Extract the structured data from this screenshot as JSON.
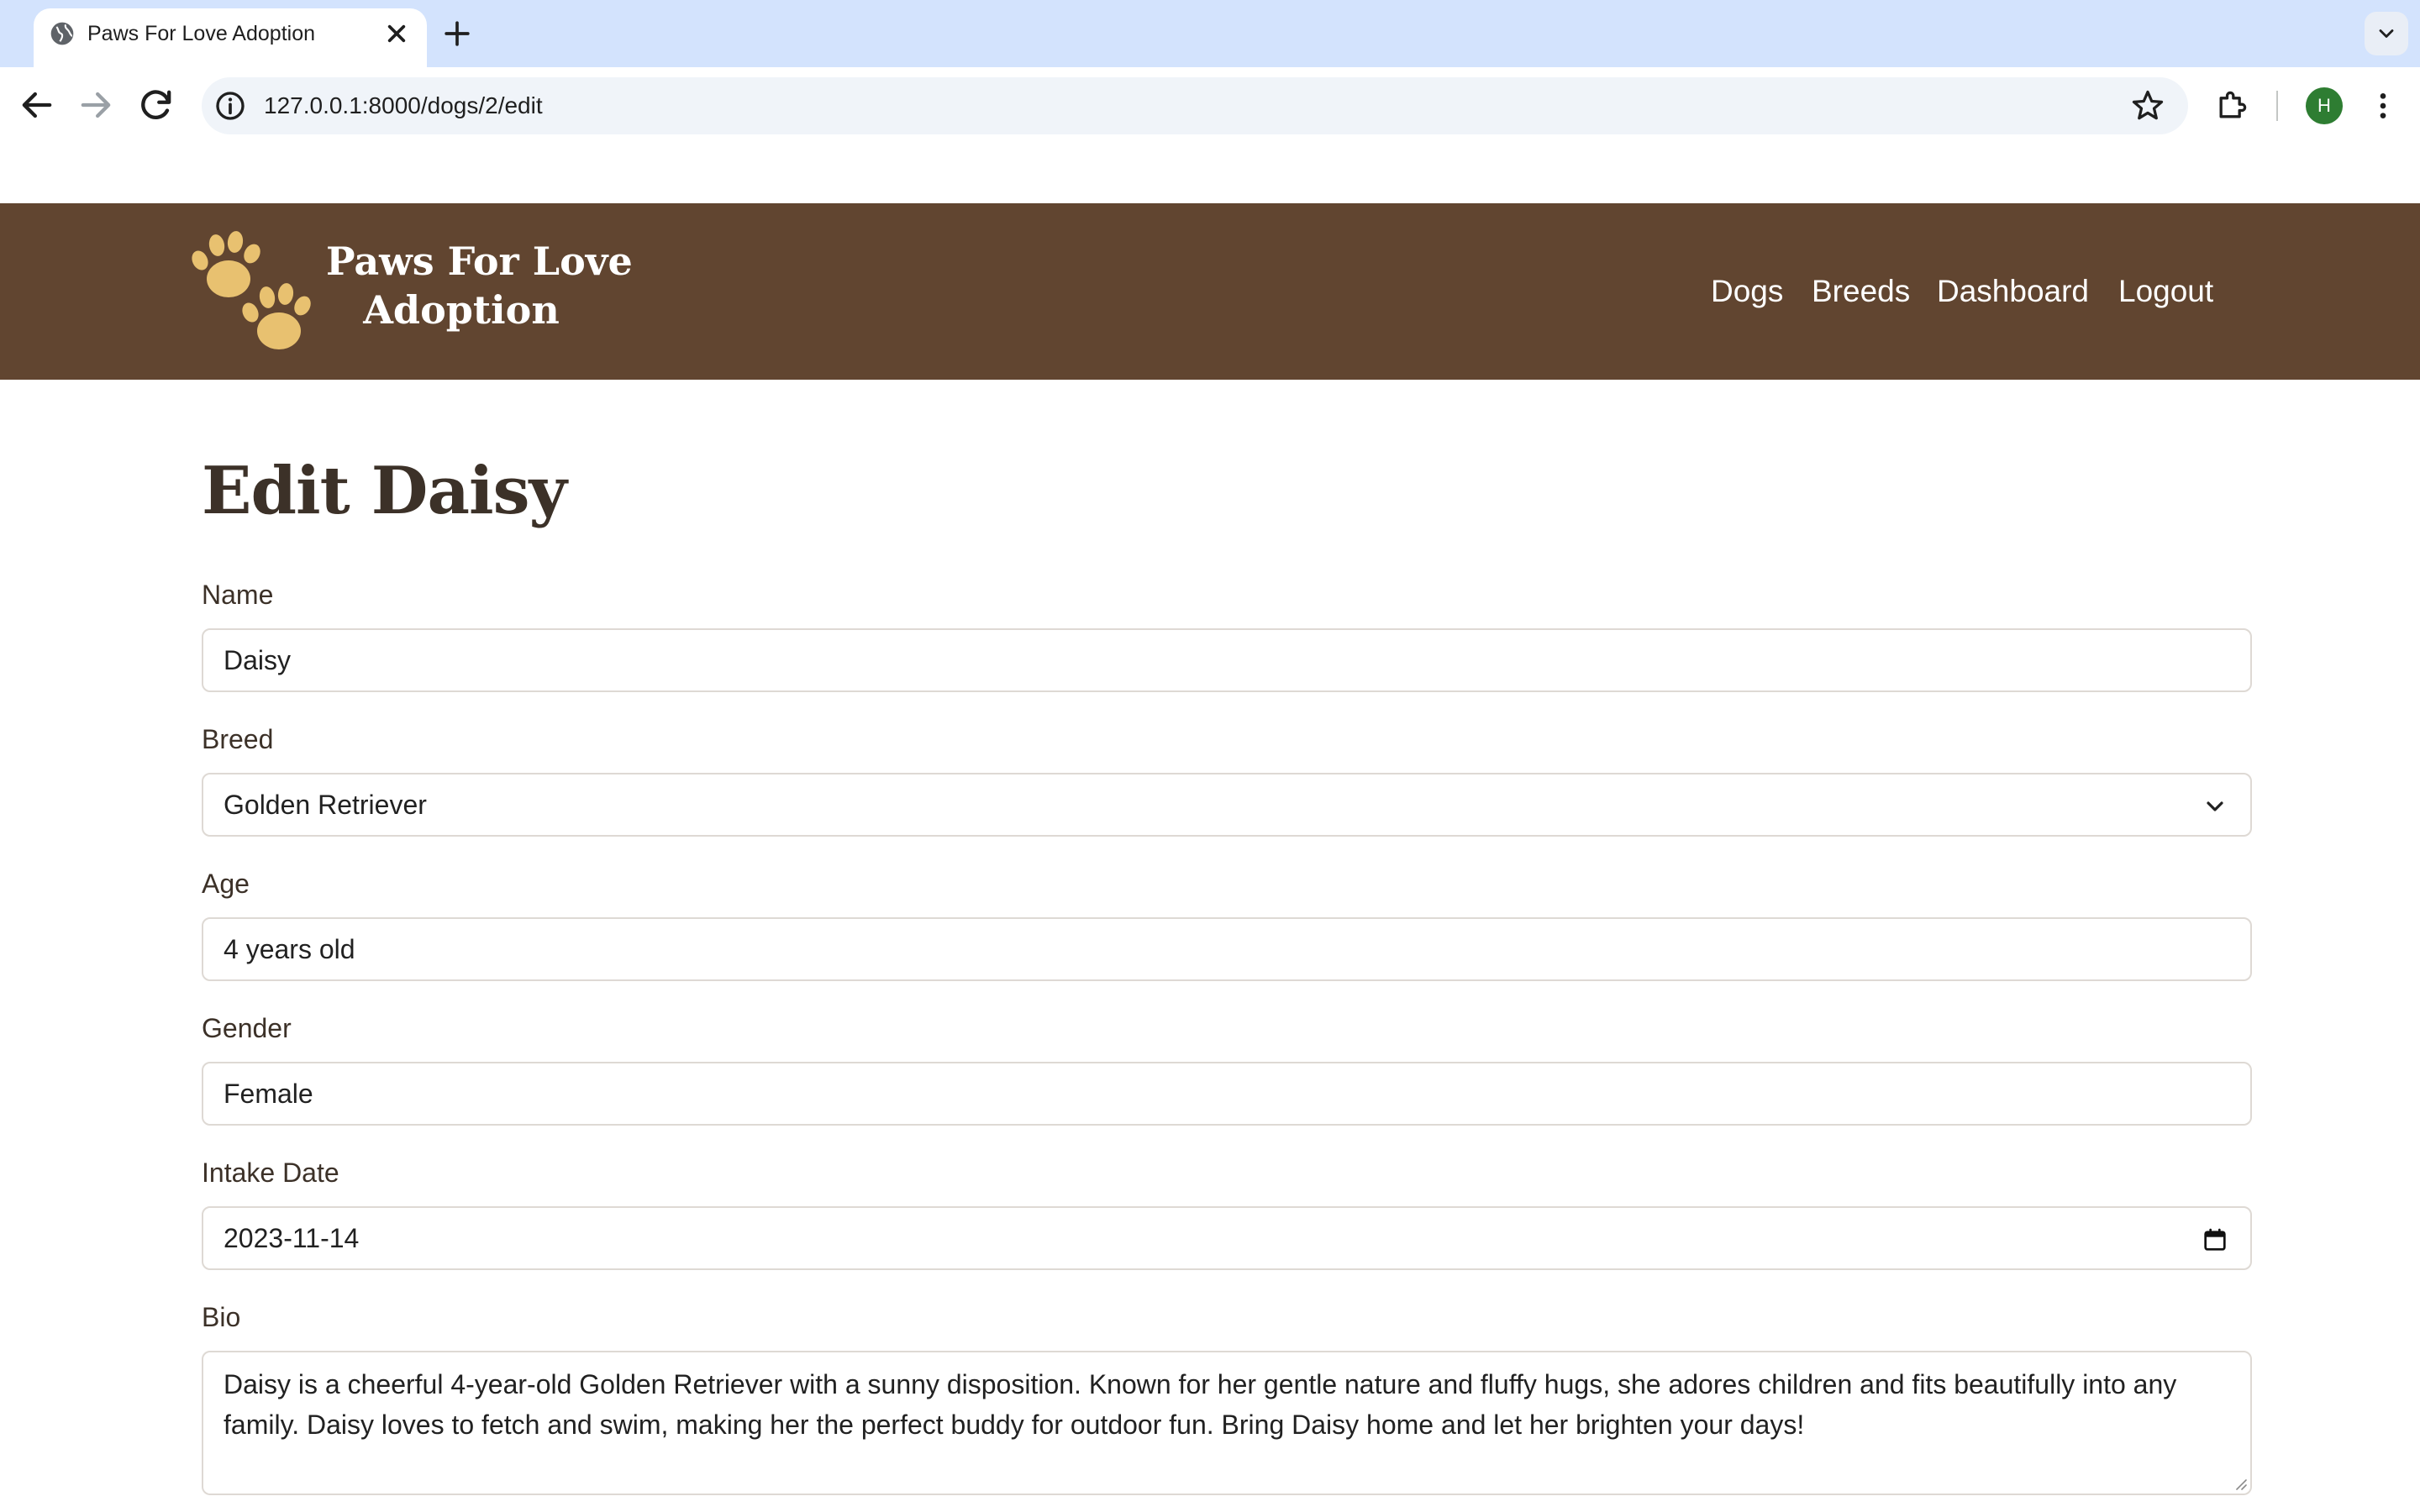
{
  "browser": {
    "tab_title": "Paws For Love Adoption",
    "url": "127.0.0.1:8000/dogs/2/edit",
    "profile_initial": "H"
  },
  "site": {
    "brand_line1": "Paws For Love",
    "brand_line2": "Adoption",
    "header_color": "#614530",
    "logo_color": "#e8c170",
    "nav": [
      "Dogs",
      "Breeds",
      "Dashboard",
      "Logout"
    ]
  },
  "form": {
    "title": "Edit Daisy",
    "name": {
      "label": "Name",
      "value": "Daisy"
    },
    "breed": {
      "label": "Breed",
      "value": "Golden Retriever"
    },
    "age": {
      "label": "Age",
      "value": "4 years old"
    },
    "gender": {
      "label": "Gender",
      "value": "Female"
    },
    "intake_date": {
      "label": "Intake Date",
      "value": "2023-11-14"
    },
    "bio": {
      "label": "Bio",
      "value": "Daisy is a cheerful 4-year-old Golden Retriever with a sunny disposition. Known for her gentle nature and fluffy hugs, she adores children and fits beautifully into any family. Daisy loves to fetch and swim, making her the perfect buddy for outdoor fun. Bring Daisy home and let her brighten your days!"
    }
  },
  "icons": [
    "globe-icon",
    "close-icon",
    "plus-icon",
    "chevron-down-icon",
    "back-arrow-icon",
    "forward-arrow-icon",
    "reload-icon",
    "info-icon",
    "star-icon",
    "extensions-icon",
    "more-vert-icon",
    "paw-icon",
    "calendar-icon"
  ]
}
